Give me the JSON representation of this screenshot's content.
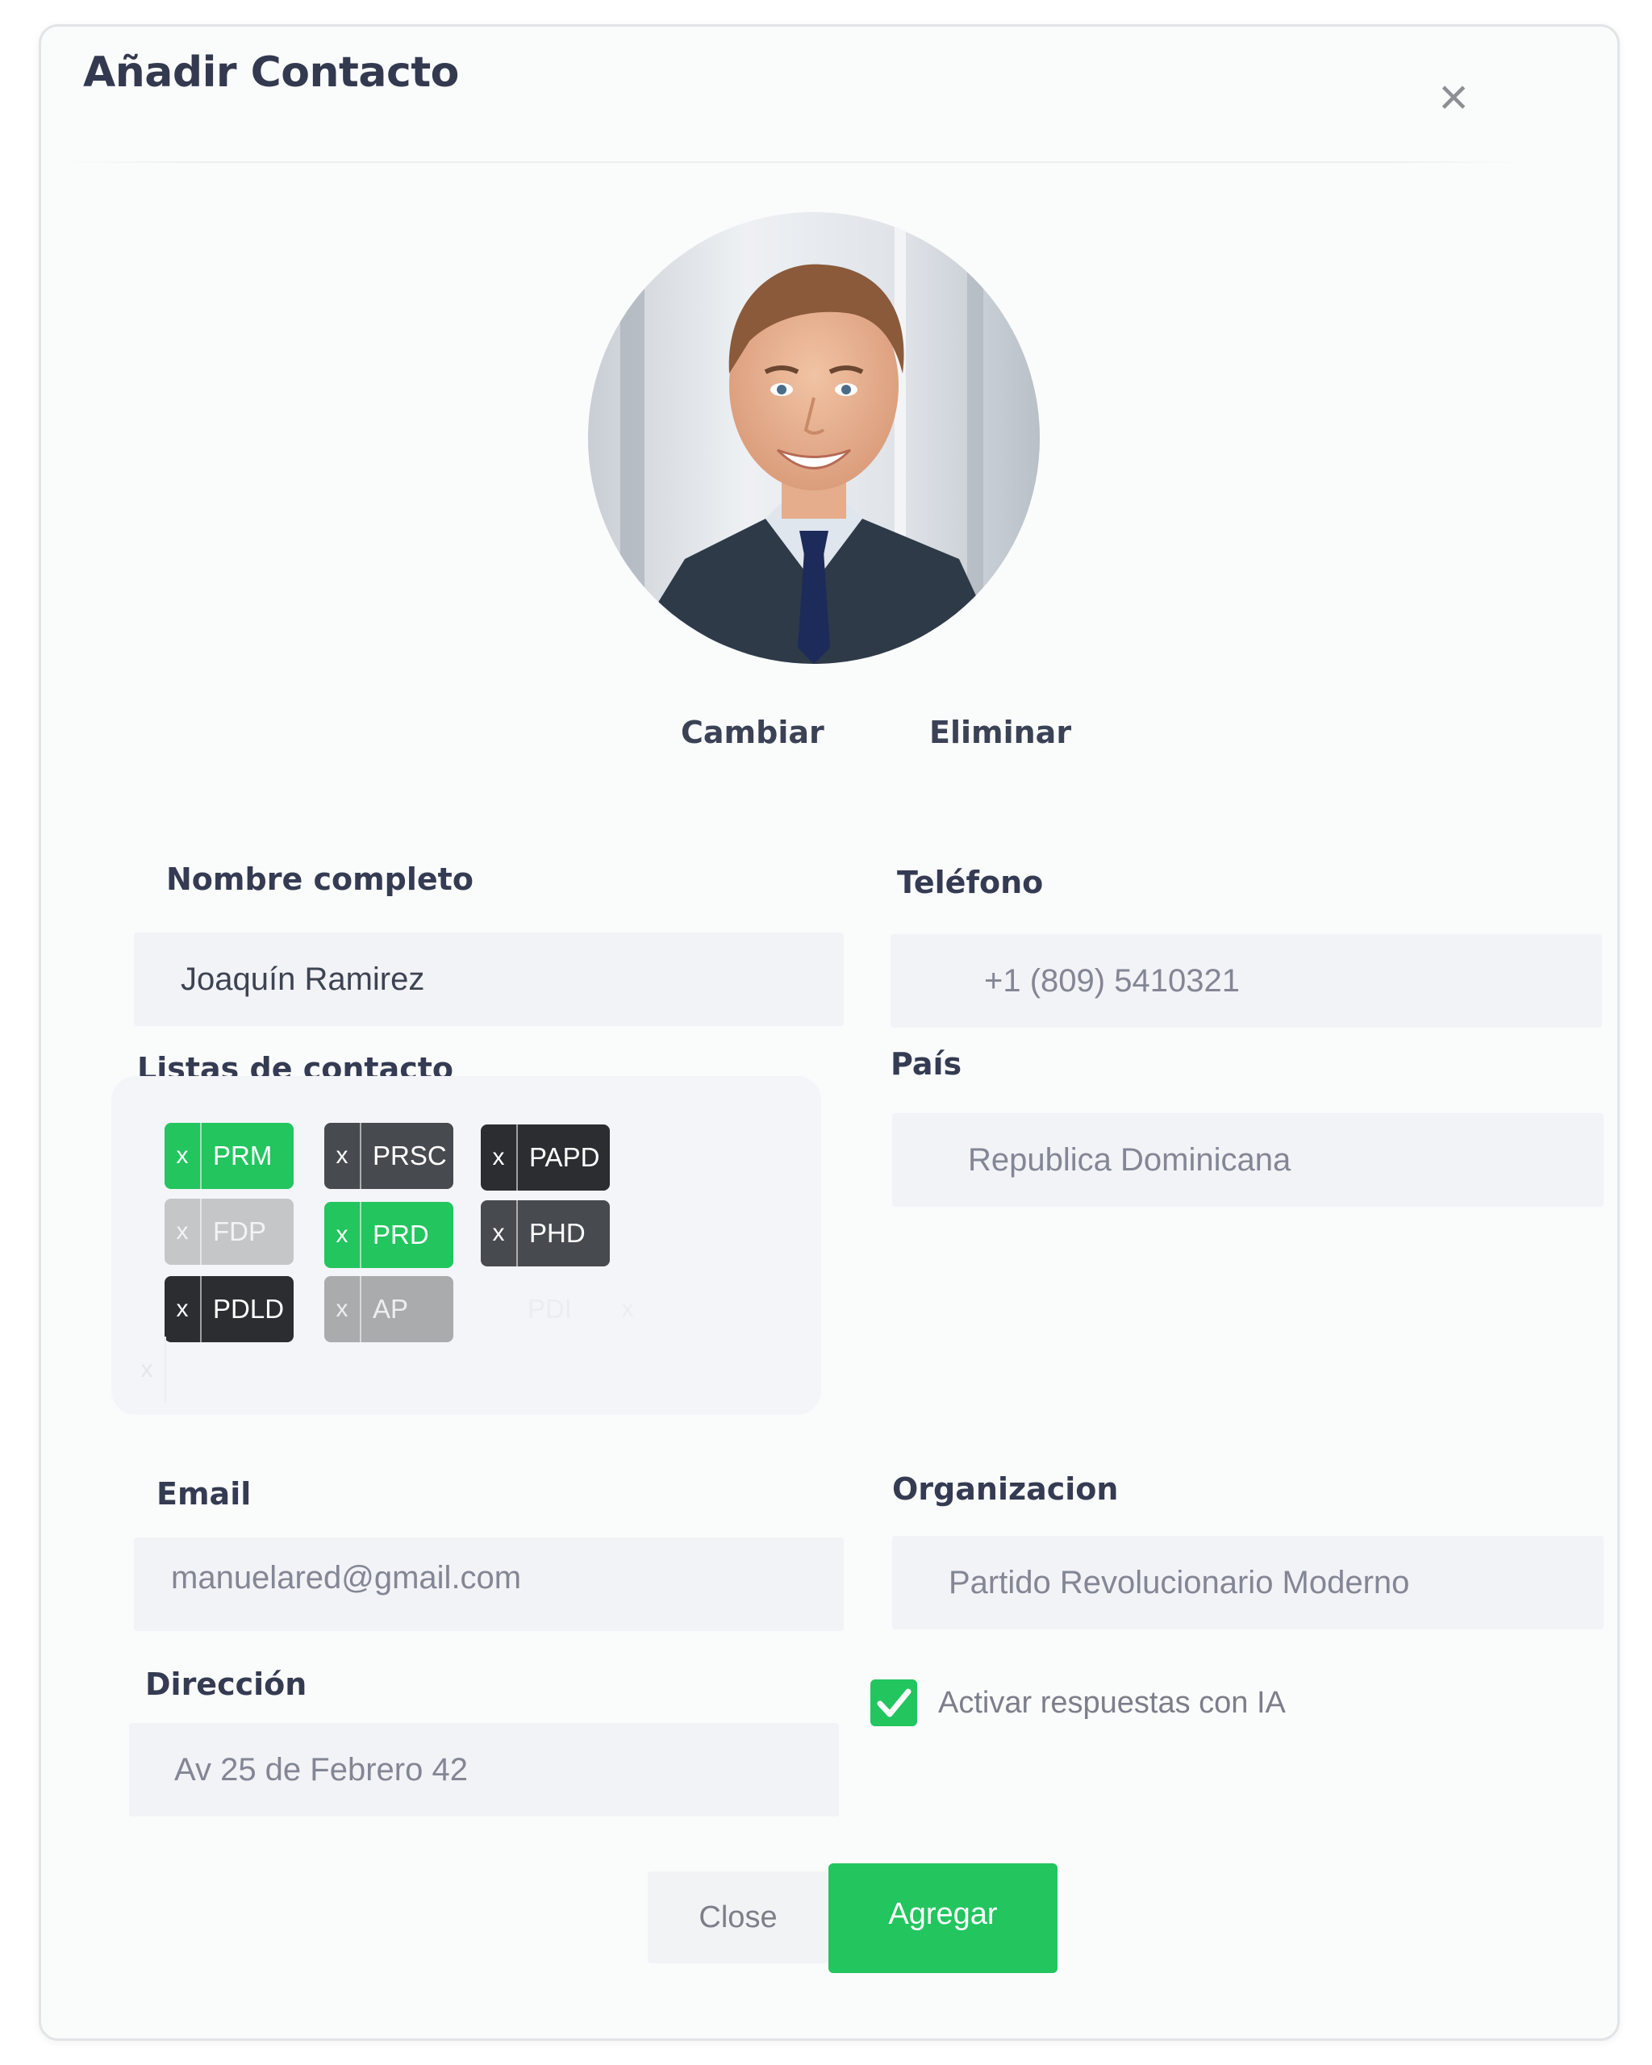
{
  "modal": {
    "title": "Añadir Contacto",
    "close_icon": "×"
  },
  "photo": {
    "change_label": "Cambiar",
    "delete_label": "Eliminar"
  },
  "form": {
    "name": {
      "label": "Nombre completo",
      "value": "Joaquín Ramirez"
    },
    "phone": {
      "label": "Teléfono",
      "value": "+1 (809) 5410321"
    },
    "lists": {
      "label": "Listas de contacto",
      "remove_glyph": "x",
      "tags": [
        {
          "label": "PRM",
          "style": "green"
        },
        {
          "label": "PRSC",
          "style": "dgray"
        },
        {
          "label": "PAPD",
          "style": "black"
        },
        {
          "label": "FDP",
          "style": "lgray"
        },
        {
          "label": "PRD",
          "style": "green"
        },
        {
          "label": "PHD",
          "style": "dgray"
        },
        {
          "label": "PDLD",
          "style": "black"
        },
        {
          "label": "AP",
          "style": "mgray"
        },
        {
          "label": "PDI",
          "style": "ghost"
        }
      ]
    },
    "country": {
      "label": "País",
      "value": "Republica Dominicana"
    },
    "email": {
      "label": "Email",
      "value": "manuelared@gmail.com"
    },
    "organization": {
      "label": "Organizacion",
      "value": "Partido Revolucionario Moderno"
    },
    "address": {
      "label": "Dirección",
      "value": "Av 25 de Febrero 42"
    },
    "ai_toggle": {
      "label": "Activar respuestas con IA",
      "checked": true
    }
  },
  "footer": {
    "close_label": "Close",
    "submit_label": "Agregar"
  },
  "colors": {
    "accent_green": "#22c55e",
    "title_text": "#333a4f",
    "field_bg": "#f2f3f7"
  },
  "icons": {
    "close": "close-icon",
    "check": "check-icon",
    "remove_tag": "x-icon"
  }
}
